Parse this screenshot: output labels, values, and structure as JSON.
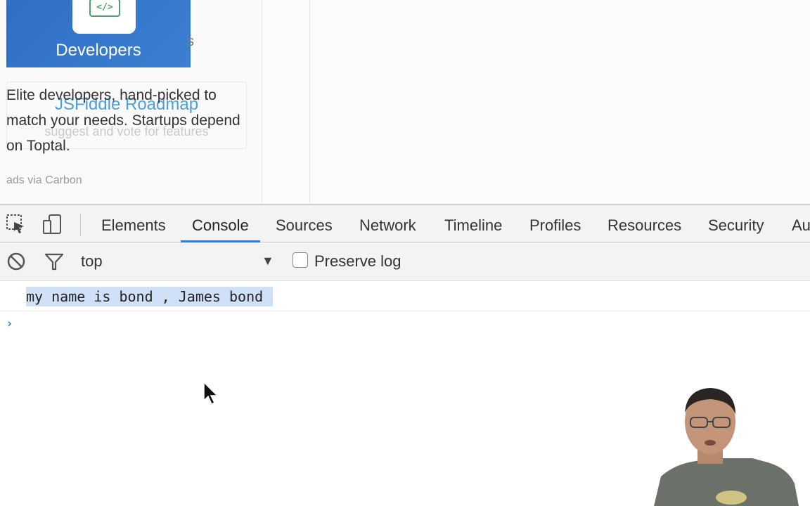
{
  "ad": {
    "brand": "Developers",
    "badge_glyph": "</>",
    "trailing_fragment": "s",
    "roadmap_title": "JSFiddle Roadmap",
    "roadmap_sub": "suggest and vote for features",
    "copy": "Elite developers, hand-picked to match your needs. Startups depend on Toptal.",
    "via": "ads via Carbon"
  },
  "devtools": {
    "tabs": [
      "Elements",
      "Console",
      "Sources",
      "Network",
      "Timeline",
      "Profiles",
      "Resources",
      "Security",
      "Au"
    ],
    "active_tab": "Console",
    "context": "top",
    "preserve_log_label": "Preserve log",
    "preserve_log_checked": false,
    "log": "my name is bond , James bond",
    "prompt": "›"
  },
  "icons": [
    "inspect-icon",
    "device-icon",
    "clear-console-icon",
    "filter-icon",
    "dropdown-arrow-icon",
    "mouse-cursor-icon"
  ],
  "colors": {
    "accent": "#3879d9",
    "selection": "#cfe0f7",
    "link": "#3c95d9"
  }
}
